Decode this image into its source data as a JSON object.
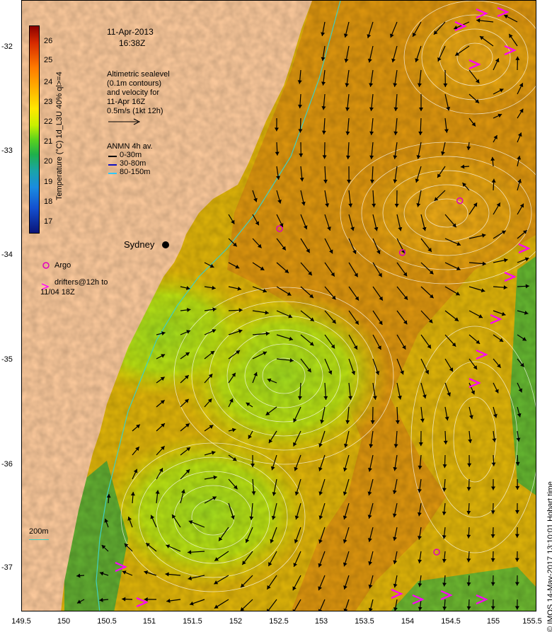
{
  "header": {
    "date": "11-Apr-2013",
    "time": "16:38Z"
  },
  "altimetry_note": {
    "line1": "Altimetric sealevel",
    "line2": "(0.1m contours)",
    "line3": "and velocity for",
    "line4": "11-Apr 16Z",
    "line5": "0.5m/s (1kt 12h)"
  },
  "anmn_legend": {
    "title": "ANMN 4h av.",
    "items": [
      {
        "label": "0-30m",
        "color": "#000000"
      },
      {
        "label": "30-80m",
        "color": "#1010c0"
      },
      {
        "label": "80-150m",
        "color": "#30c8ff"
      }
    ]
  },
  "colorbar": {
    "title": "Temperature (°C) 1d_L3U 40% ql>=4",
    "ticks": [
      "26",
      "25",
      "24",
      "23",
      "22",
      "21",
      "20",
      "19",
      "18",
      "17"
    ]
  },
  "labels": {
    "city": "Sydney",
    "argo": "Argo",
    "drifters": "drifters@12h to",
    "drifters_line2": "11/04 18Z",
    "isobath": "200m",
    "stamp": "© IMOS 14-May-2017 13:10:01 Hobart time"
  },
  "axes": {
    "lat_ticks": [
      "-32",
      "-33",
      "-34",
      "-35",
      "-36",
      "-37"
    ],
    "lon_ticks": [
      "149.5",
      "150",
      "150.5",
      "151",
      "151.5",
      "152",
      "152.5",
      "153",
      "153.5",
      "154",
      "154.5",
      "155",
      "155.5"
    ]
  },
  "colors": {
    "land": "#f9c79a",
    "warm": "#d9820f",
    "mid": "#e8b800",
    "cool": "#a8d81a",
    "cold": "#39b54a",
    "argo": "#e000c0",
    "drifter": "#ff00ff",
    "contour": "#ffffff"
  },
  "argo_floats": [
    {
      "lon": 152.5,
      "lat": -33.95
    },
    {
      "lon": 153.93,
      "lat": -34.18
    },
    {
      "lon": 154.6,
      "lat": -33.68
    },
    {
      "lon": 154.33,
      "lat": -37.07
    }
  ]
}
